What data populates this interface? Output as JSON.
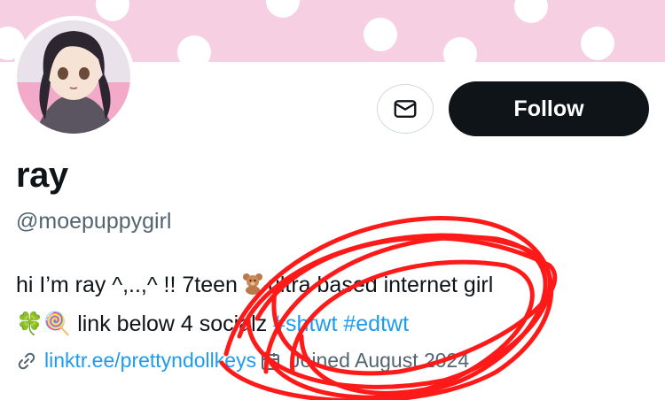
{
  "profile": {
    "name": "ray",
    "handle": "@moepuppygirl",
    "follow_label": "Follow",
    "bio_line1_a": "hi I’m ray ^,..,^ !! 7teen",
    "bio_line1_b": "ultra based internet girl",
    "bio_line2_a": "🍀🍭 link below 4 socialz",
    "hashtag1": "#shtwt",
    "hashtag2": "#edtwt",
    "link": "linktr.ee/prettyndollkeys",
    "joined": "Joined August 2024"
  },
  "icons": {
    "message": "envelope-icon",
    "link": "link-icon",
    "calendar": "calendar-icon",
    "bear": "teddy-bear-emoji"
  },
  "colors": {
    "banner": "#f6cfe2",
    "follow_bg": "#0f1419",
    "link": "#1d9bf0",
    "muted": "#536471",
    "annotation": "#ff0000"
  }
}
